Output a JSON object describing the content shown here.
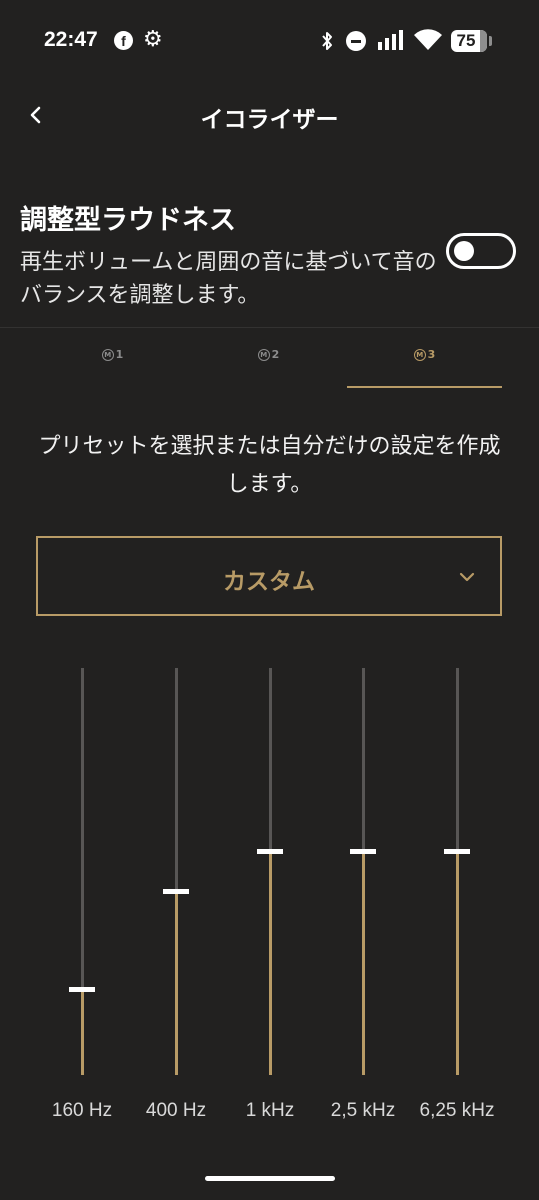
{
  "status_bar": {
    "time": "22:47",
    "battery": "75",
    "icons": [
      "facebook-icon",
      "gear-icon",
      "bluetooth-icon",
      "do-not-disturb-icon",
      "signal-icon",
      "wifi-icon",
      "battery-icon"
    ]
  },
  "header": {
    "title": "イコライザー",
    "back_icon": "chevron-left-icon"
  },
  "loudness": {
    "title": "調整型ラウドネス",
    "description": "再生ボリュームと周囲の音に基づいて音のバランスを調整します。",
    "enabled": false
  },
  "tabs": [
    {
      "icon": "M",
      "label": "1",
      "active": false
    },
    {
      "icon": "M",
      "label": "2",
      "active": false
    },
    {
      "icon": "M",
      "label": "3",
      "active": true
    }
  ],
  "instruction": "プリセットを選択または自分だけの設定を作成します。",
  "preset": {
    "selected": "カスタム",
    "icon": "chevron-down-icon"
  },
  "equalizer": {
    "bands": [
      {
        "label": "160 Hz",
        "level": 0.21
      },
      {
        "label": "400 Hz",
        "level": 0.45
      },
      {
        "label": "1 kHz",
        "level": 0.55
      },
      {
        "label": "2,5 kHz",
        "level": 0.55
      },
      {
        "label": "6,25 kHz",
        "level": 0.55
      }
    ]
  },
  "colors": {
    "background": "#222120",
    "accent": "#b89b66",
    "track": "#585655",
    "text": "#ffffff"
  }
}
